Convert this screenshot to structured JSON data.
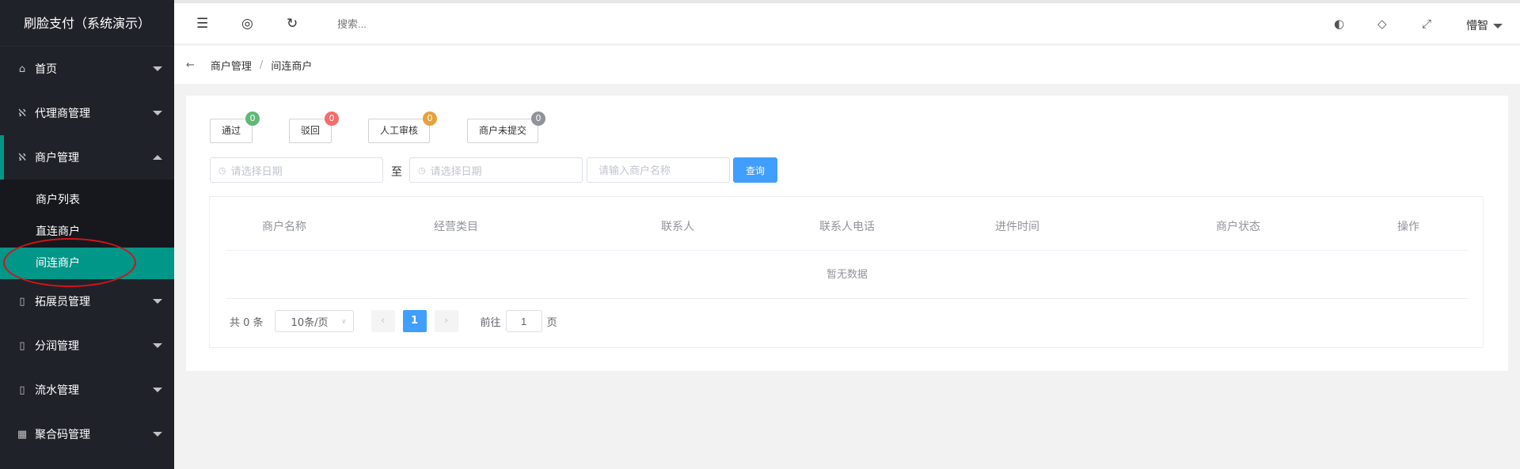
{
  "brand": "刷脸支付（系统演示）",
  "sidebar": {
    "items": [
      {
        "label": "首页",
        "icon": "home-icon"
      },
      {
        "label": "代理商管理",
        "icon": "user-icon"
      },
      {
        "label": "商户管理",
        "icon": "user-icon"
      },
      {
        "label": "拓展员管理",
        "icon": "clipboard-icon"
      },
      {
        "label": "分润管理",
        "icon": "clipboard-icon"
      },
      {
        "label": "流水管理",
        "icon": "clipboard-icon"
      },
      {
        "label": "聚合码管理",
        "icon": "qrcode-icon"
      }
    ],
    "submenu": [
      "商户列表",
      "直连商户",
      "间连商户"
    ],
    "active_color": "#009688"
  },
  "header": {
    "search_placeholder": "搜索...",
    "user": "懵智"
  },
  "breadcrumb": {
    "items": [
      "商户管理",
      "间连商户"
    ],
    "separator": "/"
  },
  "filters": {
    "tags": [
      {
        "label": "通过",
        "count": "0",
        "color": "#5fb878"
      },
      {
        "label": "驳回",
        "count": "0",
        "color": "#f56c6c"
      },
      {
        "label": "人工审核",
        "count": "0",
        "color": "#e6a23c"
      },
      {
        "label": "商户未提交",
        "count": "0",
        "color": "#909399"
      }
    ],
    "start_date_placeholder": "请选择日期",
    "to_label": "至",
    "end_date_placeholder": "请选择日期",
    "name_placeholder": "请输入商户名称",
    "query_label": "查询"
  },
  "table": {
    "columns": [
      "商户名称",
      "经营类目",
      "联系人",
      "联系人电话",
      "进件时间",
      "商户状态",
      "操作"
    ],
    "empty_text": "暂无数据"
  },
  "pagination": {
    "total": "共 0 条",
    "page_size": "10条/页",
    "current_page": "1",
    "goto_label": "前往",
    "goto_value": "1",
    "page_unit": "页"
  }
}
